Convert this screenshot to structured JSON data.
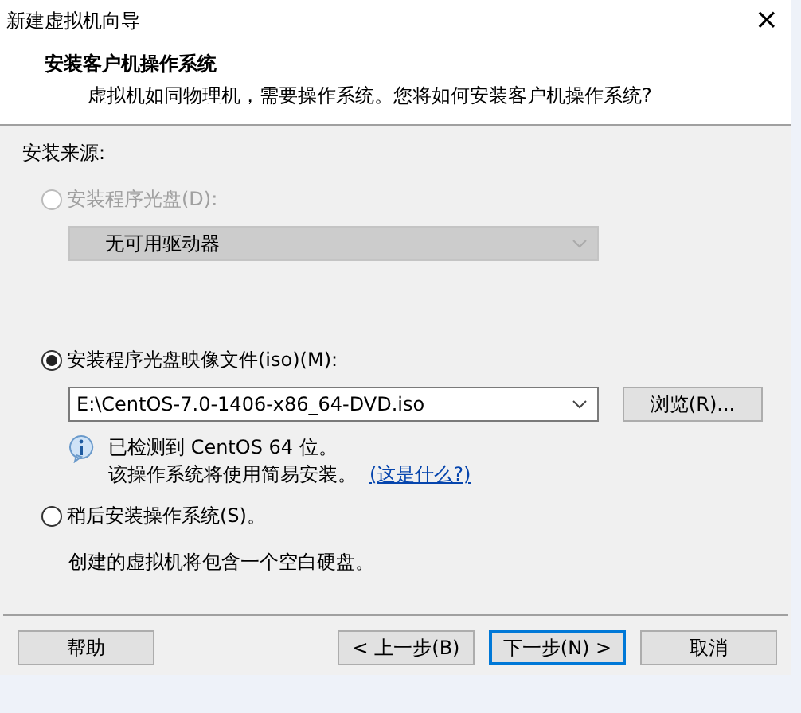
{
  "window": {
    "title": "新建虚拟机向导",
    "close": "×"
  },
  "header": {
    "title": "安装客户机操作系统",
    "subtitle": "虚拟机如同物理机，需要操作系统。您将如何安装客户机操作系统?"
  },
  "source_label": "安装来源:",
  "options": [
    {
      "kind": "disc",
      "label": "安装程序光盘(D):",
      "selected": false,
      "disabled": true,
      "dropdown": "无可用驱动器"
    },
    {
      "kind": "iso",
      "label": "安装程序光盘映像文件(iso)(M):",
      "selected": true,
      "disabled": false,
      "dropdown": "E:\\CentOS-7.0-1406-x86_64-DVD.iso",
      "browse": "浏览(R)...",
      "info": [
        "已检测到 CentOS 64 位。",
        "该操作系统将使用简易安装。"
      ],
      "link": "(这是什么?)"
    },
    {
      "kind": "later",
      "label": "稍后安装操作系统(S)。",
      "selected": false,
      "disabled": false,
      "note": "创建的虚拟机将包含一个空白硬盘。"
    }
  ],
  "buttons": [
    {
      "label": "帮助",
      "default": false,
      "kind": "left"
    },
    {
      "label": "< 上一步(B)",
      "default": false,
      "kind": "right"
    },
    {
      "label": "下一步(N) >",
      "default": true,
      "kind": "right"
    },
    {
      "label": "取消",
      "default": false,
      "kind": "right"
    }
  ]
}
